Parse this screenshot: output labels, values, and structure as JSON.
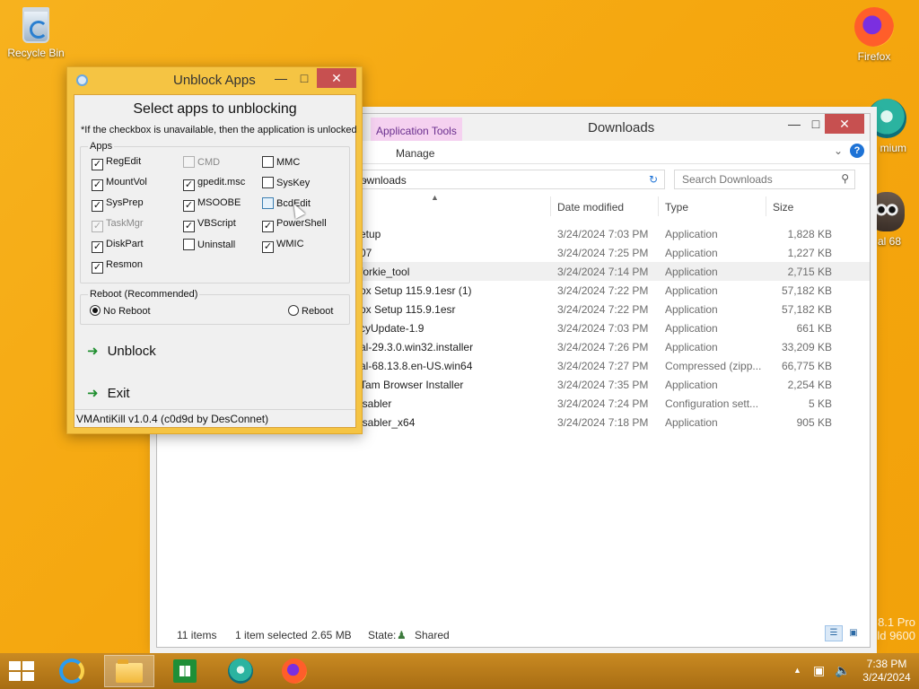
{
  "desktop": {
    "icons": [
      {
        "label": "Recycle Bin"
      },
      {
        "label": "Firefox"
      },
      {
        "label": "mium"
      },
      {
        "label": "al 68"
      }
    ],
    "watermark_line1": "8.1 Pro",
    "watermark_line2": "ld 9600"
  },
  "explorer": {
    "title": "Downloads",
    "context_tab": "Application Tools",
    "ribbon_tab": "Manage",
    "address": "ownloads",
    "search_placeholder": "Search Downloads",
    "columns": [
      "Date modified",
      "Type",
      "Size"
    ],
    "rows": [
      {
        "name": "etup",
        "date": "3/24/2024 7:03 PM",
        "type": "Application",
        "size": "1,828 KB"
      },
      {
        "name": "07",
        "date": "3/24/2024 7:25 PM",
        "type": "Application",
        "size": "1,227 KB"
      },
      {
        "name": "forkie_tool",
        "date": "3/24/2024 7:14 PM",
        "type": "Application",
        "size": "2,715 KB"
      },
      {
        "name": "ox Setup 115.9.1esr (1)",
        "date": "3/24/2024 7:22 PM",
        "type": "Application",
        "size": "57,182 KB"
      },
      {
        "name": "ox Setup 115.9.1esr",
        "date": "3/24/2024 7:22 PM",
        "type": "Application",
        "size": "57,182 KB"
      },
      {
        "name": "cyUpdate-1.9",
        "date": "3/24/2024 7:03 PM",
        "type": "Application",
        "size": "661 KB"
      },
      {
        "name": "al-29.3.0.win32.installer",
        "date": "3/24/2024 7:26 PM",
        "type": "Application",
        "size": "33,209 KB"
      },
      {
        "name": "al-68.13.8.en-US.win64",
        "date": "3/24/2024 7:27 PM",
        "type": "Compressed (zipp...",
        "size": "66,775 KB"
      },
      {
        "name": "Tam Browser Installer",
        "date": "3/24/2024 7:35 PM",
        "type": "Application",
        "size": "2,254 KB"
      },
      {
        "name": "isabler",
        "date": "3/24/2024 7:24 PM",
        "type": "Configuration sett...",
        "size": "5 KB"
      },
      {
        "name": "isabler_x64",
        "date": "3/24/2024 7:18 PM",
        "type": "Application",
        "size": "905 KB"
      }
    ],
    "status": {
      "items": "11 items",
      "selected": "1 item selected",
      "selected_size": "2.65 MB",
      "state_label": "State:",
      "state_value": "Shared"
    }
  },
  "dialog": {
    "title": "Unblock Apps",
    "heading": "Select apps to unblocking",
    "note": "*If the checkbox is unavailable, then the application is unlocked",
    "apps_group": "Apps",
    "apps": [
      {
        "label": "RegEdit",
        "checked": true,
        "disabled": false
      },
      {
        "label": "CMD",
        "checked": false,
        "disabled": true
      },
      {
        "label": "MMC",
        "checked": false,
        "disabled": false
      },
      {
        "label": "MountVol",
        "checked": true,
        "disabled": false
      },
      {
        "label": "gpedit.msc",
        "checked": true,
        "disabled": false
      },
      {
        "label": "SysKey",
        "checked": false,
        "disabled": false
      },
      {
        "label": "SysPrep",
        "checked": true,
        "disabled": false
      },
      {
        "label": "MSOOBE",
        "checked": true,
        "disabled": false
      },
      {
        "label": "BcdEdit",
        "checked": false,
        "disabled": false
      },
      {
        "label": "TaskMgr",
        "checked": true,
        "disabled": true
      },
      {
        "label": "VBScript",
        "checked": true,
        "disabled": false
      },
      {
        "label": "PowerShell",
        "checked": true,
        "disabled": false
      },
      {
        "label": "DiskPart",
        "checked": true,
        "disabled": false
      },
      {
        "label": "Uninstall",
        "checked": false,
        "disabled": false
      },
      {
        "label": "WMIC",
        "checked": true,
        "disabled": false
      },
      {
        "label": "Resmon",
        "checked": true,
        "disabled": false
      }
    ],
    "reboot_group": "Reboot (Recommended)",
    "reboot_options": [
      {
        "label": "No Reboot",
        "selected": true
      },
      {
        "label": "Reboot",
        "selected": false
      }
    ],
    "unblock_label": "Unblock",
    "exit_label": "Exit",
    "footer": "VMAntiKill v1.0.4 (c0d9d by DesConnet)"
  },
  "taskbar": {
    "time": "7:38 PM",
    "date": "3/24/2024"
  },
  "colors": {
    "desktop_accent": "#f5a70f",
    "dialog_frame": "#f5c443",
    "close_red": "#c75050",
    "app_tools_tab": "#f5d1f0",
    "action_arrow": "#1f8f2f"
  }
}
